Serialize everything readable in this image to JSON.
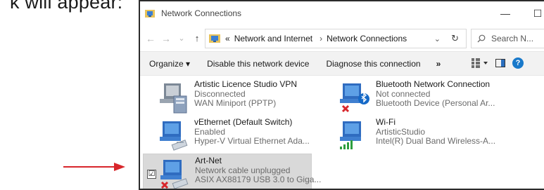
{
  "background_caption": "k will appear:",
  "window": {
    "title": "Network Connections",
    "controls": {
      "minimize": "—",
      "maximize": "☐",
      "close": "✕"
    }
  },
  "nav": {
    "back": "←",
    "forward": "→",
    "recent": "⌄",
    "up": "↑"
  },
  "address": {
    "overflow": "«",
    "crumb1": "Network and Internet",
    "separator": "›",
    "crumb2": "Network Connections",
    "dropdown": "⌄",
    "refresh": "↻"
  },
  "search": {
    "placeholder": "Search N..."
  },
  "toolbar": {
    "organize": "Organize ▾",
    "disable": "Disable this network device",
    "diagnose": "Diagnose this connection",
    "more": "»",
    "help": "?"
  },
  "connections": [
    {
      "name": "Artistic Licence Studio VPN",
      "status": "Disconnected",
      "device": "WAN Miniport (PPTP)"
    },
    {
      "name": "Bluetooth Network Connection",
      "status": "Not connected",
      "device": "Bluetooth Device (Personal Ar..."
    },
    {
      "name": "vEthernet (Default Switch)",
      "status": "Enabled",
      "device": "Hyper-V Virtual Ethernet Ada..."
    },
    {
      "name": "Wi-Fi",
      "status": "ArtisticStudio",
      "device": "Intel(R) Dual Band Wireless-A..."
    },
    {
      "name": "Art-Net",
      "status": "Network cable unplugged",
      "device": "ASIX AX88179 USB 3.0 to Giga..."
    }
  ],
  "selected_checkbox": "☑",
  "colors": {
    "arrow": "#d8262b",
    "error_x": "#d8262b",
    "help": "#1979ca",
    "bluetooth": "#1569c7",
    "wifi": "#2e9e3e"
  }
}
